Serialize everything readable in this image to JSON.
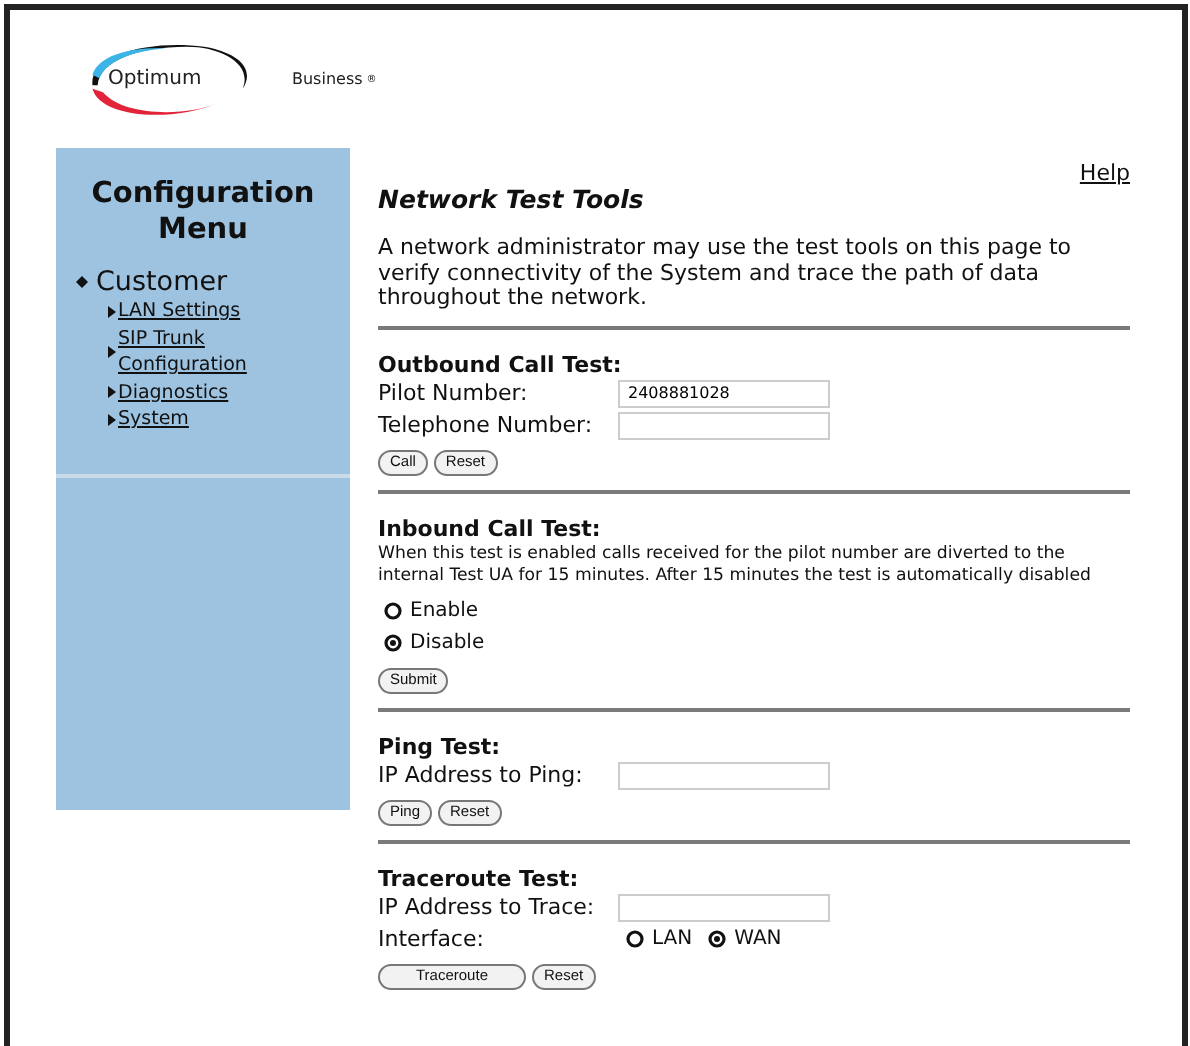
{
  "logo": {
    "name": "Optimum",
    "tagline": "Business",
    "mark": "®"
  },
  "sidebar": {
    "title": "Configuration Menu",
    "section": "Customer",
    "items": [
      {
        "label": "LAN Settings"
      },
      {
        "label": "SIP Trunk Configuration"
      },
      {
        "label": "Diagnostics"
      },
      {
        "label": "System"
      }
    ]
  },
  "help": "Help",
  "title": "Network Test Tools",
  "intro": "A network administrator may use the test tools on this page to verify connectivity of the System and trace the path of data throughout the network.",
  "sections": [
    {
      "heading": "Outbound Call Test:",
      "fields": [
        {
          "label": "Pilot Number:",
          "value": "2408881028"
        },
        {
          "label": "Telephone Number:"
        }
      ],
      "buttons": [
        "Call",
        "Reset"
      ]
    },
    {
      "heading": "Inbound Call Test:",
      "description": "When this test is enabled calls received for the pilot number are diverted to the internal Test UA for 15 minutes. After 15 minutes the test is automatically disabled",
      "options": [
        {
          "label": "Enable",
          "selected": false
        },
        {
          "label": "Disable",
          "selected": true
        }
      ],
      "buttons": [
        "Submit"
      ]
    },
    {
      "heading": "Ping Test:",
      "fields": [
        {
          "label": "IP Address to Ping:"
        }
      ],
      "buttons": [
        "Ping",
        "Reset"
      ]
    },
    {
      "heading": "Traceroute Test:",
      "fields": [
        {
          "label": "IP Address to Trace:"
        }
      ],
      "interface": {
        "label": "Interface:",
        "options": [
          {
            "label": "LAN",
            "selected": false
          },
          {
            "label": "WAN",
            "selected": true
          }
        ]
      },
      "buttons": [
        "Traceroute",
        "Reset"
      ]
    }
  ]
}
